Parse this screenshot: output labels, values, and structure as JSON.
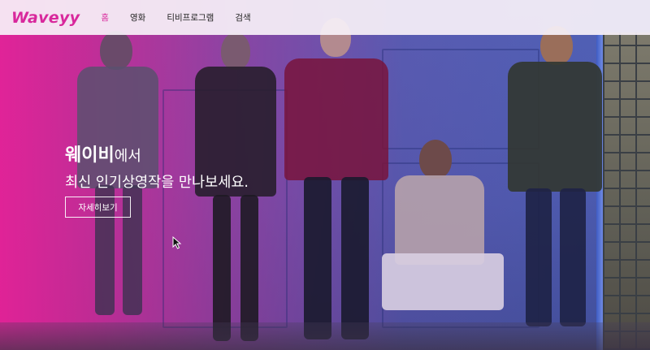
{
  "header": {
    "logo": "Waveyy",
    "nav": [
      {
        "label": "홈",
        "active": true
      },
      {
        "label": "영화",
        "active": false
      },
      {
        "label": "티비프로그램",
        "active": false
      },
      {
        "label": "검색",
        "active": false
      }
    ]
  },
  "hero": {
    "title_brand": "웨이비",
    "title_rest": "에서",
    "subtitle": "최신 인기상영작을 만나보세요.",
    "cta_label": "자세히보기"
  },
  "colors": {
    "brand_pink": "#d8289c",
    "nav_background": "#f6f0f8",
    "hero_text": "#ffffff"
  },
  "icons": [
    "mouse-pointer-icon"
  ]
}
